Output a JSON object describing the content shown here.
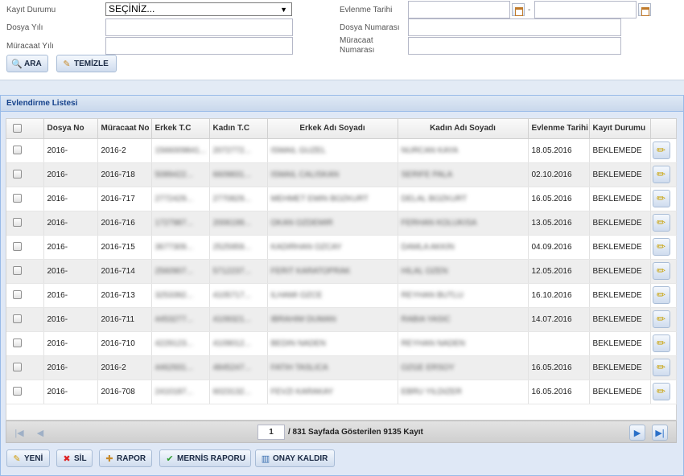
{
  "search": {
    "kayit_durumu_label": "Kayıt Durumu",
    "kayit_durumu_value": "SEÇİNİZ...",
    "dosya_yili_label": "Dosya Yılı",
    "muracaat_yili_label": "Müracaat Yılı",
    "evlenme_tarihi_label": "Evlenme Tarihi",
    "date_separator": "-",
    "dosya_numarasi_label": "Dosya Numarası",
    "muracaat_numarasi_label_1": "Müracaat",
    "muracaat_numarasi_label_2": "Numarası",
    "ara_label": "ARA",
    "temizle_label": "TEMİZLE"
  },
  "grid": {
    "title": "Evlendirme Listesi",
    "columns": [
      "Dosya No",
      "Müracaat No",
      "Erkek T.C",
      "Kadın T.C",
      "Erkek Adı Soyadı",
      "Kadın Adı Soyadı",
      "Evlenme Tarihi",
      "Kayıt Durumu"
    ],
    "rows": [
      {
        "dosya": "2016-",
        "muracaat": "2016-2",
        "erkek_tc": "1566009841...",
        "kadin_tc": "2072772...",
        "erkek": "ISMAIL GUZEL",
        "kadin": "NURCAN KAYA",
        "tarih": "18.05.2016",
        "durum": "BEKLEMEDE"
      },
      {
        "dosya": "2016-",
        "muracaat": "2016-718",
        "erkek_tc": "5089422...",
        "kadin_tc": "6609831...",
        "erkek": "ISMAIL CALISKAN",
        "kadin": "SERIFE PALA",
        "tarih": "02.10.2016",
        "durum": "BEKLEMEDE"
      },
      {
        "dosya": "2016-",
        "muracaat": "2016-717",
        "erkek_tc": "2772429...",
        "kadin_tc": "2770829...",
        "erkek": "MEHMET EMIN BOZKURT",
        "kadin": "DELAL BOZKURT",
        "tarih": "16.05.2016",
        "durum": "BEKLEMEDE"
      },
      {
        "dosya": "2016-",
        "muracaat": "2016-716",
        "erkek_tc": "1727987...",
        "kadin_tc": "2006199...",
        "erkek": "OKAN OZDEMIR",
        "kadin": "FERHAN KOLUKISA",
        "tarih": "13.05.2016",
        "durum": "BEKLEMEDE"
      },
      {
        "dosya": "2016-",
        "muracaat": "2016-715",
        "erkek_tc": "3677309...",
        "kadin_tc": "2525959...",
        "erkek": "KADIRHAN OZCAY",
        "kadin": "DAMLA AKKIN",
        "tarih": "04.09.2016",
        "durum": "BEKLEMEDE"
      },
      {
        "dosya": "2016-",
        "muracaat": "2016-714",
        "erkek_tc": "2560907...",
        "kadin_tc": "5712237...",
        "erkek": "FERIT KARATOPRAK",
        "kadin": "HILAL OZEN",
        "tarih": "12.05.2016",
        "durum": "BEKLEMEDE"
      },
      {
        "dosya": "2016-",
        "muracaat": "2016-713",
        "erkek_tc": "3253392...",
        "kadin_tc": "4105717...",
        "erkek": "ILHAMI OZCE",
        "kadin": "REYHAN BUTLU",
        "tarih": "16.10.2016",
        "durum": "BEKLEMEDE"
      },
      {
        "dosya": "2016-",
        "muracaat": "2016-711",
        "erkek_tc": "4453277...",
        "kadin_tc": "4109321...",
        "erkek": "IBRAHIM DUMAN",
        "kadin": "RABIA YASIC",
        "tarih": "14.07.2016",
        "durum": "BEKLEMEDE"
      },
      {
        "dosya": "2016-",
        "muracaat": "2016-710",
        "erkek_tc": "4229123...",
        "kadin_tc": "4109012...",
        "erkek": "BEDIN NADEN",
        "kadin": "REYHAN NADEN",
        "tarih": "",
        "durum": "BEKLEMEDE"
      },
      {
        "dosya": "2016-",
        "muracaat": "2016-2",
        "erkek_tc": "4462931...",
        "kadin_tc": "4845247...",
        "erkek": "FATIH TASLICA",
        "kadin": "OZGE ERSOY",
        "tarih": "16.05.2016",
        "durum": "BEKLEMEDE"
      },
      {
        "dosya": "2016-",
        "muracaat": "2016-708",
        "erkek_tc": "2410187...",
        "kadin_tc": "6023132...",
        "erkek": "FEVZI KARAKAY",
        "kadin": "EBRU YILDIZER",
        "tarih": "16.05.2016",
        "durum": "BEKLEMEDE"
      }
    ]
  },
  "pager": {
    "page": "1",
    "summary": "/ 831 Sayfada Gösterilen 9135 Kayıt"
  },
  "actions": {
    "yeni": "YENİ",
    "sil": "SİL",
    "rapor": "RAPOR",
    "mernis_raporu": "MERNİS RAPORU",
    "onay_kaldir": "ONAY KALDIR"
  }
}
